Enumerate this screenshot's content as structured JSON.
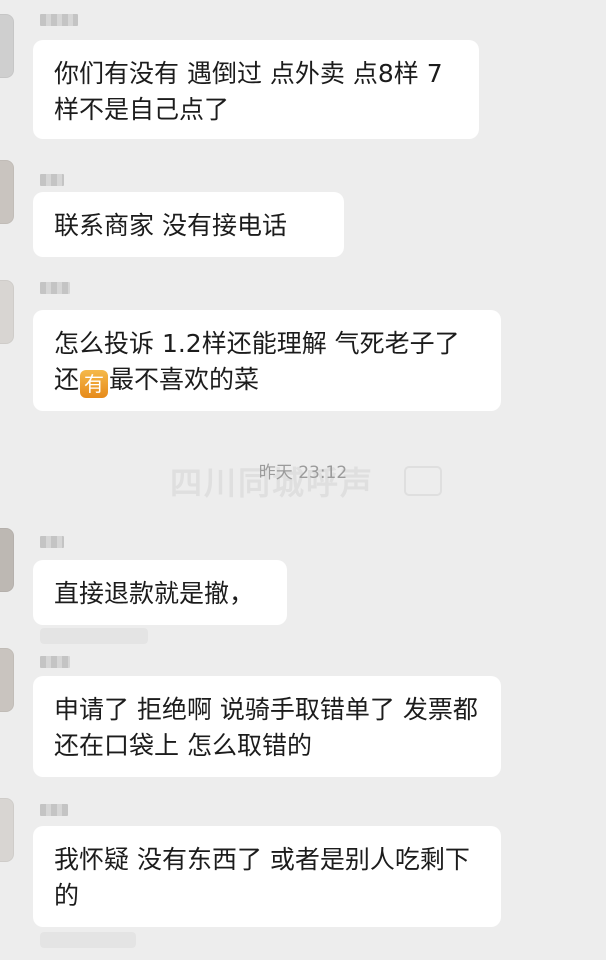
{
  "messages": [
    {
      "text": "你们有没有 遇倒过 点外卖  点8样 7样不是自己点了"
    },
    {
      "text": "联系商家 没有接电话"
    },
    {
      "text_before": "怎么投诉 1.2样还能理解 气死老子了 还",
      "emoji": "有",
      "text_after": "最不喜欢的菜"
    },
    {
      "text": "直接退款就是撤，"
    },
    {
      "text": "申请了 拒绝啊 说骑手取错单了 发票都还在口袋上  怎么取错的"
    },
    {
      "text": "我怀疑 没有东西了 或者是别人吃剩下的"
    }
  ],
  "timestamp": "昨天 23:12",
  "watermark": "四川同城呼声"
}
